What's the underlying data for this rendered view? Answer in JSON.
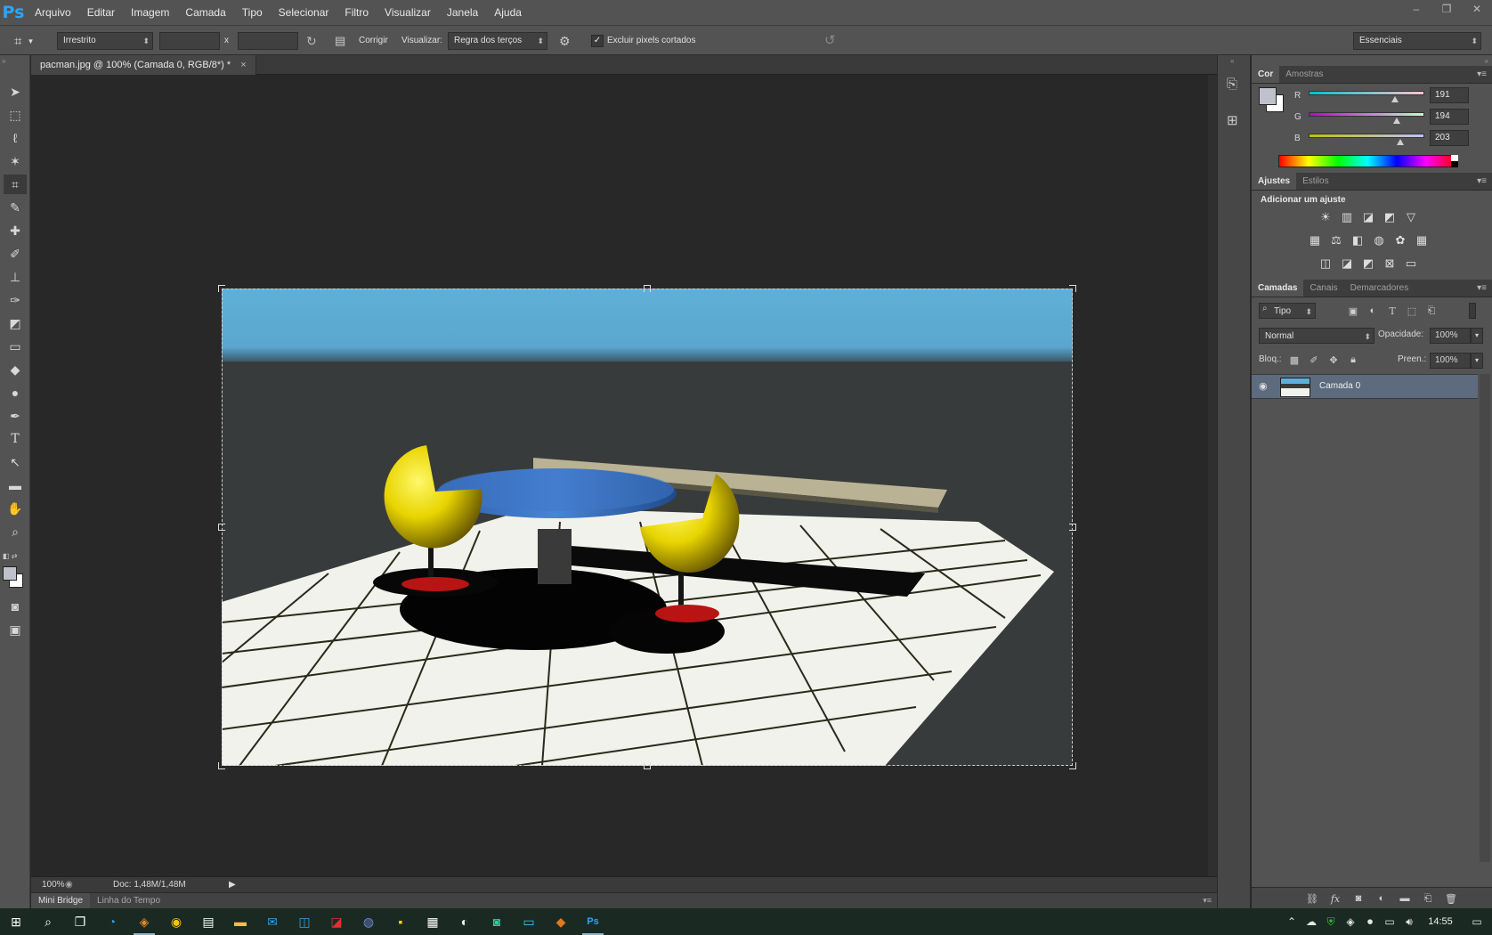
{
  "app": {
    "logo": "Ps"
  },
  "menu": [
    "Arquivo",
    "Editar",
    "Imagem",
    "Camada",
    "Tipo",
    "Selecionar",
    "Filtro",
    "Visualizar",
    "Janela",
    "Ajuda"
  ],
  "window_controls": {
    "minimize": "–",
    "restore": "❐",
    "close": "✕"
  },
  "options": {
    "ratio_select": "Irrestrito",
    "width_value": "",
    "height_value": "",
    "separator": "x",
    "straighten_label": "Corrigir",
    "view_label": "Visualizar:",
    "view_select": "Regra dos terços",
    "delete_cropped_label": "Excluir pixels cortados",
    "delete_cropped_checked": true,
    "workspace_select": "Essenciais"
  },
  "document": {
    "tab_title": "pacman.jpg @ 100% (Camada 0, RGB/8*) *",
    "tab_close": "×",
    "zoom": "100%",
    "doc_size": "Doc: 1,48M/1,48M"
  },
  "bottom_tabs": [
    "Mini Bridge",
    "Linha do Tempo"
  ],
  "color_panel": {
    "tabs": [
      "Cor",
      "Amostras"
    ],
    "channels": [
      {
        "label": "R",
        "value": "191",
        "level": 0.749
      },
      {
        "label": "G",
        "value": "194",
        "level": 0.761
      },
      {
        "label": "B",
        "value": "203",
        "level": 0.796
      }
    ],
    "foreground": "#bfc2cb",
    "background": "#ffffff"
  },
  "adjustments_panel": {
    "tabs": [
      "Ajustes",
      "Estilos"
    ],
    "heading": "Adicionar um ajuste"
  },
  "layers_panel": {
    "tabs": [
      "Camadas",
      "Canais",
      "Demarcadores"
    ],
    "filter_select": "Tipo",
    "blend_mode": "Normal",
    "opacity_label": "Opacidade:",
    "opacity_value": "100%",
    "lock_label": "Bloq.:",
    "fill_label": "Preen.:",
    "fill_value": "100%",
    "layers": [
      {
        "name": "Camada 0",
        "visible": true,
        "selected": true
      }
    ]
  },
  "taskbar": {
    "clock": "14:55"
  }
}
